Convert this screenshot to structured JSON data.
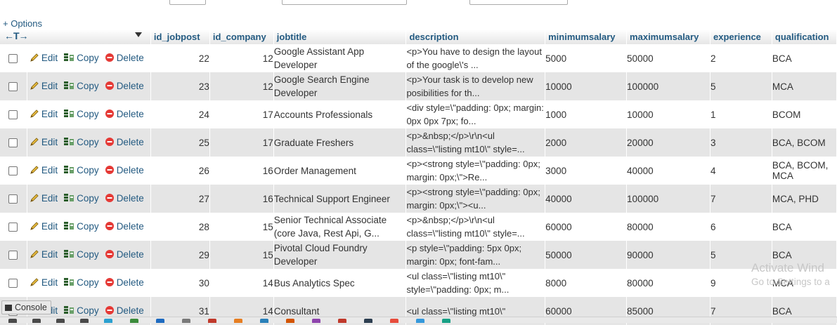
{
  "options_link": "+ Options",
  "columns": [
    "id_jobpost",
    "id_company",
    "jobtitle",
    "description",
    "minimumsalary",
    "maximumsalary",
    "experience",
    "qualification"
  ],
  "actions": {
    "edit": "Edit",
    "copy": "Copy",
    "delete": "Delete"
  },
  "rows": [
    {
      "id_jobpost": "22",
      "id_company": "12",
      "jobtitle": "Google Assistant App Developer",
      "description": "<p>You have to design the layout of the google\\'s ...",
      "minimumsalary": "5000",
      "maximumsalary": "50000",
      "experience": "2",
      "qualification": "BCA"
    },
    {
      "id_jobpost": "23",
      "id_company": "12",
      "jobtitle": "Google Search Engine Developer",
      "description": "<p>Your task is to develop new posibilities for th...",
      "minimumsalary": "10000",
      "maximumsalary": "100000",
      "experience": "5",
      "qualification": "MCA"
    },
    {
      "id_jobpost": "24",
      "id_company": "17",
      "jobtitle": "Accounts Professionals",
      "description": "<div style=\\\"padding: 0px; margin: 0px 0px 7px; fo...",
      "minimumsalary": "1000",
      "maximumsalary": "10000",
      "experience": "1",
      "qualification": "BCOM"
    },
    {
      "id_jobpost": "25",
      "id_company": "17",
      "jobtitle": "Graduate Freshers",
      "description": "<p>&nbsp;</p>\\r\\n<ul class=\\\"listing mt10\\\" style=...",
      "minimumsalary": "2000",
      "maximumsalary": "20000",
      "experience": "3",
      "qualification": "BCA, BCOM"
    },
    {
      "id_jobpost": "26",
      "id_company": "16",
      "jobtitle": "Order Management",
      "description": "<p><strong style=\\\"padding: 0px; margin: 0px;\\\">Re...",
      "minimumsalary": "3000",
      "maximumsalary": "40000",
      "experience": "4",
      "qualification": "BCA, BCOM, MCA"
    },
    {
      "id_jobpost": "27",
      "id_company": "16",
      "jobtitle": "Technical Support Engineer",
      "description": "<p><strong style=\\\"padding: 0px; margin: 0px;\\\"><u...",
      "minimumsalary": "40000",
      "maximumsalary": "100000",
      "experience": "7",
      "qualification": "MCA, PHD"
    },
    {
      "id_jobpost": "28",
      "id_company": "15",
      "jobtitle": "Senior Technical Associate (core Java, Rest Api, G...",
      "description": "<p>&nbsp;</p>\\r\\n<ul class=\\\"listing mt10\\\" style=...",
      "minimumsalary": "60000",
      "maximumsalary": "80000",
      "experience": "6",
      "qualification": "BCA"
    },
    {
      "id_jobpost": "29",
      "id_company": "15",
      "jobtitle": "Pivotal Cloud Foundry Developer",
      "description": "<p style=\\\"padding: 5px 0px; margin: 0px; font-fam...",
      "minimumsalary": "50000",
      "maximumsalary": "90000",
      "experience": "5",
      "qualification": "BCA"
    },
    {
      "id_jobpost": "30",
      "id_company": "14",
      "jobtitle": "Bus Analytics Spec",
      "description": "<ul class=\\\"listing mt10\\\" style=\\\"padding: 0px; m...",
      "minimumsalary": "8000",
      "maximumsalary": "80000",
      "experience": "9",
      "qualification": "MCA"
    },
    {
      "id_jobpost": "31",
      "id_company": "14",
      "jobtitle": "Consultant",
      "description": "<ul class=\\\"listing mt10\\\"",
      "minimumsalary": "60000",
      "maximumsalary": "85000",
      "experience": "7",
      "qualification": "BCA"
    }
  ],
  "console_label": "Console",
  "watermark": {
    "line1": "Activate Wind",
    "line2": "Go to Settings to a"
  }
}
